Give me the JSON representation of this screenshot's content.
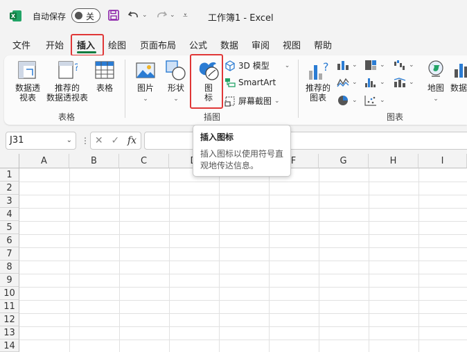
{
  "titlebar": {
    "autosave_label": "自动保存",
    "autosave_state": "关",
    "doc_title": "工作簿1  -  Excel",
    "icons": [
      "excel-logo-icon",
      "save-icon",
      "undo-icon",
      "redo-icon",
      "customize-icon"
    ]
  },
  "tabs": [
    {
      "label": "文件"
    },
    {
      "label": "开始"
    },
    {
      "label": "插入",
      "active": true
    },
    {
      "label": "绘图"
    },
    {
      "label": "页面布局"
    },
    {
      "label": "公式"
    },
    {
      "label": "数据"
    },
    {
      "label": "审阅"
    },
    {
      "label": "视图"
    },
    {
      "label": "帮助"
    }
  ],
  "ribbon": {
    "tables_group": {
      "label": "表格",
      "pivot_label": "数据透\n视表",
      "recommended_pivot_label": "推荐的\n数据透视表",
      "table_label": "表格"
    },
    "illustrations_group": {
      "label": "插图",
      "pictures_label": "图片",
      "shapes_label": "形状",
      "icons_label": "图\n标",
      "models3d_label": "3D 模型",
      "smartart_label": "SmartArt",
      "screenshot_label": "屏幕截图"
    },
    "charts_group": {
      "label": "图表",
      "recommended_charts_label": "推荐的\n图表",
      "maps_label": "地图",
      "pivotchart_label": "数据"
    }
  },
  "formula_bar": {
    "name_box": "J31",
    "fx_label": "fx",
    "formula_value": ""
  },
  "grid": {
    "columns": [
      "A",
      "B",
      "C",
      "D",
      "E",
      "F",
      "G",
      "H",
      "I"
    ],
    "rows": [
      "1",
      "2",
      "3",
      "4",
      "5",
      "6",
      "7",
      "8",
      "9",
      "10",
      "11",
      "12",
      "13",
      "14"
    ]
  },
  "tooltip": {
    "title": "插入图标",
    "body": "插入图标以使用符号直观地传达信息。"
  },
  "colors": {
    "accent_green": "#117a3e",
    "highlight_red": "#e03636",
    "icon_blue": "#2b7cd3"
  }
}
